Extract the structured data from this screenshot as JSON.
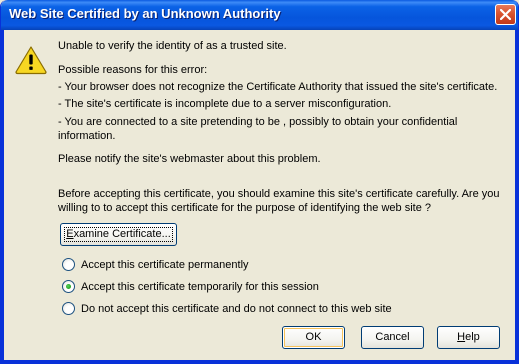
{
  "window": {
    "title": "Web Site Certified by an Unknown Authority",
    "close_label": "Close"
  },
  "message": {
    "intro": "Unable to verify the identity of as a trusted site.",
    "reasons_heading": "Possible reasons for this error:",
    "reason_1": "- Your browser does not recognize the Certificate Authority that issued the site's certificate.",
    "reason_2": "- The site's certificate is incomplete due to a server misconfiguration.",
    "reason_3": "- You are connected to a site pretending to be , possibly to obtain your confidential information.",
    "notify": "Please notify the site's webmaster about this problem.",
    "before_accepting": "Before accepting this certificate, you should examine this site's certificate carefully. Are you willing to to accept this certificate for the purpose of identifying the web site ?"
  },
  "examine_button": {
    "prefix": "E",
    "rest": "xamine Certificate..."
  },
  "options": [
    {
      "label": "Accept this certificate permanently",
      "selected": false
    },
    {
      "label": "Accept this certificate temporarily for this session",
      "selected": true
    },
    {
      "label": "Do not accept this certificate and do not connect to this web site",
      "selected": false
    }
  ],
  "buttons": {
    "ok": "OK",
    "cancel": "Cancel",
    "help_prefix": "H",
    "help_rest": "elp"
  },
  "colors": {
    "titlebar": "#0655dc",
    "dialog_bg": "#ece9d8",
    "warning": "#f7d722",
    "radio_selected": "#21a121"
  },
  "icons": {
    "warning": "warning-triangle-icon",
    "close": "close-icon"
  }
}
